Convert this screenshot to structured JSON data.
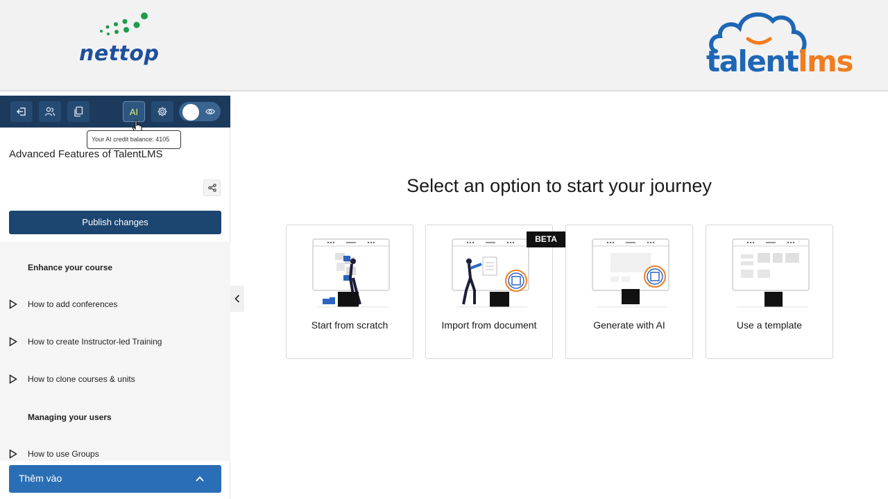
{
  "brand": {
    "nettop_name": "nettop",
    "talentlms_name_part1": "talent",
    "talentlms_name_part2": "lms",
    "colors": {
      "nettop_blue": "#1d4f9c",
      "nettop_green": "#1e9b4b",
      "talent_blue": "#1f66b4",
      "talent_orange": "#ef7d22"
    }
  },
  "toolbar": {
    "ai_label": "AI",
    "tooltip": "Your AI credit balance: 4105",
    "icons": [
      "exit-icon",
      "users-icon",
      "copy-icon",
      "ai-icon",
      "gear-icon",
      "eye-icon"
    ]
  },
  "course": {
    "title": "Advanced Features of TalentLMS",
    "publish_label": "Publish changes"
  },
  "toc": {
    "sections": [
      {
        "title": "Enhance your course"
      },
      {
        "title": "Managing your users"
      }
    ],
    "items": [
      {
        "label": "How to add conferences"
      },
      {
        "label": "How to create Instructor-led Training"
      },
      {
        "label": "How to clone courses & units"
      },
      {
        "label": "How to use Groups"
      }
    ]
  },
  "add_panel": {
    "label": "Thêm vào"
  },
  "main": {
    "heading": "Select an option to start your journey",
    "beta_badge": "BETA",
    "options": [
      {
        "label": "Start from scratch"
      },
      {
        "label": "Import from document"
      },
      {
        "label": "Generate with AI"
      },
      {
        "label": "Use a template"
      }
    ]
  }
}
